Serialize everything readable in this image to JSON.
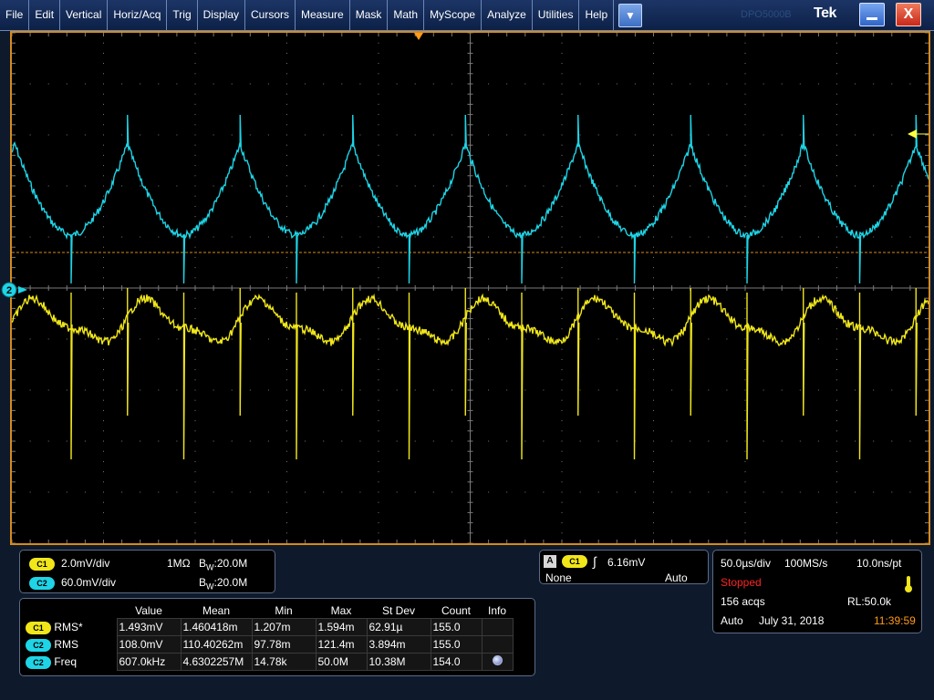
{
  "menu": {
    "items": [
      "File",
      "Edit",
      "Vertical",
      "Horiz/Acq",
      "Trig",
      "Display",
      "Cursors",
      "Measure",
      "Mask",
      "Math",
      "MyScope",
      "Analyze",
      "Utilities",
      "Help"
    ],
    "dropdown_icon": "chevron-down-icon",
    "model_text": "DPO5000B",
    "brand": "Tek",
    "minimize_icon": "minimize-icon",
    "close_icon": "close-icon",
    "close_glyph": "X"
  },
  "display": {
    "trace_colors": {
      "ch1": "#f0e61a",
      "ch2": "#1ed4e6",
      "grid": "#7a7a7a",
      "trigger_level": "#d58a1e",
      "border": "#d58a1e"
    },
    "ch2_marker": "2",
    "trigger_marker_icon": "trigger-position-triangle-icon",
    "trigger_level_icon": "trigger-level-arrow-icon"
  },
  "channels": {
    "c1": {
      "tag": "C1",
      "scale": "2.0mV/div",
      "impedance": "1MΩ",
      "bw_prefix": "B",
      "bw_sub": "W",
      "bw": ":20.0M"
    },
    "c2": {
      "tag": "C2",
      "scale": "60.0mV/div",
      "bw_prefix": "B",
      "bw_sub": "W",
      "bw": ":20.0M"
    }
  },
  "trigger": {
    "mode_letter": "A",
    "source": "C1",
    "slope_icon": "rising-edge-icon",
    "slope_glyph": "∫",
    "level": "6.16mV",
    "coupling": "None",
    "mode": "Auto"
  },
  "acquisition": {
    "timebase": "50.0µs/div",
    "sample_rate": "100MS/s",
    "resolution": "10.0ns/pt",
    "status": "Stopped",
    "acqs": "156 acqs",
    "record_length": "RL:50.0k",
    "mode": "Auto",
    "date": "July 31, 2018",
    "time": "11:39:59",
    "thermometer_icon": "thermometer-icon"
  },
  "measurements": {
    "headers": [
      "Value",
      "Mean",
      "Min",
      "Max",
      "St Dev",
      "Count",
      "Info"
    ],
    "rows": [
      {
        "channel": "C1",
        "name": "RMS*",
        "value": "1.493mV",
        "mean": "1.460418m",
        "min": "1.207m",
        "max": "1.594m",
        "stdev": "62.91µ",
        "count": "155.0",
        "info": ""
      },
      {
        "channel": "C2",
        "name": "RMS",
        "value": "108.0mV",
        "mean": "110.40262m",
        "min": "97.78m",
        "max": "121.4m",
        "stdev": "3.894m",
        "count": "155.0",
        "info": ""
      },
      {
        "channel": "C2",
        "name": "Freq",
        "value": "607.0kHz",
        "mean": "4.6302257M",
        "min": "14.78k",
        "max": "50.0M",
        "stdev": "10.38M",
        "count": "154.0",
        "info": "info-icon"
      }
    ]
  }
}
